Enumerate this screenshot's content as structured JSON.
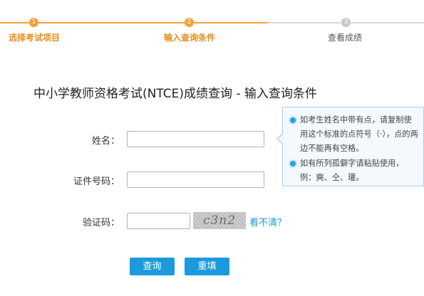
{
  "steps": [
    {
      "number": "1",
      "label": "选择考试项目",
      "state": "completed"
    },
    {
      "number": "2",
      "label": "输入查询条件",
      "state": "current"
    },
    {
      "number": "3",
      "label": "查看成绩",
      "state": "pending"
    }
  ],
  "page_title": "中小学教师资格考试(NTCE)成绩查询 - 输入查询条件",
  "form": {
    "name_label": "姓名：",
    "name_value": "",
    "id_label": "证件号码：",
    "id_value": "",
    "captcha_label": "验证码：",
    "captcha_value": "",
    "captcha_image_text": "c3n2",
    "refresh_link": "看不清？"
  },
  "tooltip": {
    "tips": [
      "如考生姓名中带有点，请复制使用这个标准的点符号（·），点的两边不能再有空格。",
      "如有所列孤僻字请粘贴使用，例：奭、仝、瓘。"
    ]
  },
  "buttons": {
    "query": "查询",
    "reset": "重填"
  },
  "colors": {
    "accent_orange": "#f0a33b",
    "accent_blue": "#1c9bdc"
  }
}
